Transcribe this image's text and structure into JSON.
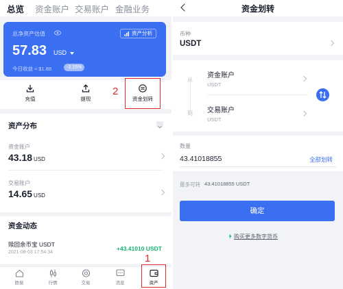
{
  "left": {
    "tabs": [
      "总览",
      "资金账户",
      "交易账户",
      "金融业务"
    ],
    "card": {
      "label": "总净资产估值",
      "analysis_label": "资产分析",
      "amount": "57.83",
      "unit": "USD",
      "today_label": "今日收益 ≈ $1.88",
      "today_pct": "-3.15%"
    },
    "actions": [
      "充值",
      "提现",
      "资金划转"
    ],
    "annotation_2": "2",
    "annotation_1": "1",
    "distribution": {
      "title": "资产分布",
      "rows": [
        {
          "label": "资金账户",
          "value": "43.18",
          "unit": "USD"
        },
        {
          "label": "交易账户",
          "value": "14.65",
          "unit": "USD"
        }
      ]
    },
    "dynamics": {
      "title": "资金动态",
      "item_name": "赎回余币宝 USDT",
      "item_date": "2021-08-03 17:54:34",
      "item_amount": "+43.41010 USDT"
    },
    "nav": [
      {
        "label": "欧易",
        "icon": "home-icon"
      },
      {
        "label": "行情",
        "icon": "candlestick-icon"
      },
      {
        "label": "交易",
        "icon": "trade-icon"
      },
      {
        "label": "消息",
        "icon": "message-icon"
      },
      {
        "label": "资产",
        "icon": "wallet-icon"
      }
    ],
    "colors": {
      "brand": "#3b6ff2",
      "annotation": "#e02a2a",
      "positive": "#15b36f"
    }
  },
  "right": {
    "title": "资金划转",
    "coin_label": "币种",
    "coin_value": "USDT",
    "from_label": "从",
    "to_label": "到",
    "from_account": "资金账户",
    "from_coin": "USDT",
    "to_account": "交易账户",
    "to_coin": "USDT",
    "qty_label": "数量",
    "qty_value": "43.41018855",
    "qty_all": "全部划转",
    "max_label": "最多可转",
    "max_value": "43.41018855 USDT",
    "confirm": "确定",
    "buy_link": "购买更多数字货币"
  }
}
